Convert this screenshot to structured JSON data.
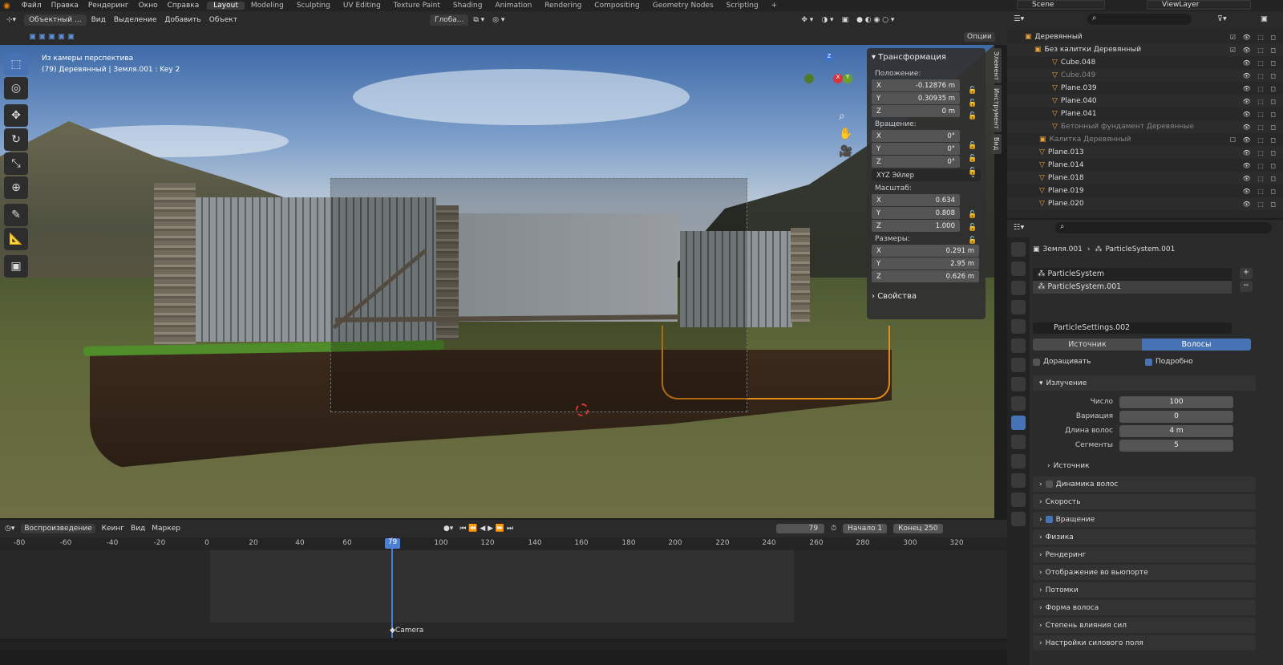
{
  "menu": [
    "Файл",
    "Правка",
    "Рендеринг",
    "Окно",
    "Справка"
  ],
  "workspaces": [
    "Layout",
    "Modeling",
    "Sculpting",
    "UV Editing",
    "Texture Paint",
    "Shading",
    "Animation",
    "Rendering",
    "Compositing",
    "Geometry Nodes",
    "Scripting"
  ],
  "active_workspace": "Layout",
  "scene": "Scene",
  "view_layer": "ViewLayer",
  "viewport_header": {
    "mode": "Объектный ...",
    "items": [
      "Вид",
      "Выделение",
      "Добавить",
      "Объект"
    ],
    "transform_orientation": "Глоба...",
    "options_label": "Опции"
  },
  "viewport_info": {
    "line1": "Из камеры перспектива",
    "line2": "(79) Деревянный | Земля.001 : Key 2"
  },
  "npanel": {
    "title": "Трансформация",
    "location_label": "Положение:",
    "location": [
      {
        "axis": "X",
        "value": "-0.12876 m"
      },
      {
        "axis": "Y",
        "value": "0.30935 m"
      },
      {
        "axis": "Z",
        "value": "0 m"
      }
    ],
    "rotation_label": "Вращение:",
    "rotation": [
      {
        "axis": "X",
        "value": "0°"
      },
      {
        "axis": "Y",
        "value": "0°"
      },
      {
        "axis": "Z",
        "value": "0°"
      }
    ],
    "rotation_mode": "XYZ Эйлер",
    "scale_label": "Масштаб:",
    "scale": [
      {
        "axis": "X",
        "value": "0.634"
      },
      {
        "axis": "Y",
        "value": "0.808"
      },
      {
        "axis": "Z",
        "value": "1.000"
      }
    ],
    "dimensions_label": "Размеры:",
    "dimensions": [
      {
        "axis": "X",
        "value": "0.291 m"
      },
      {
        "axis": "Y",
        "value": "2.95 m"
      },
      {
        "axis": "Z",
        "value": "0.626 m"
      }
    ],
    "properties_label": "Свойства",
    "tabs": [
      "Элемент",
      "Инструмент",
      "Вид"
    ]
  },
  "timeline": {
    "header": [
      "Воспроизведение",
      "Кеинг",
      "Вид",
      "Маркер"
    ],
    "current_frame": "79",
    "start_label": "Начало",
    "start": "1",
    "end_label": "Конец",
    "end": "250",
    "ruler": [
      "-80",
      "-60",
      "-40",
      "-20",
      "0",
      "20",
      "40",
      "60",
      "79",
      "100",
      "120",
      "140",
      "160",
      "180",
      "200",
      "220",
      "240",
      "260",
      "280",
      "300",
      "320"
    ],
    "marker": "Camera"
  },
  "outliner": {
    "rows": [
      {
        "name": "Деревянный",
        "dim": false
      },
      {
        "name": "Без калитки Деревянный",
        "dim": false
      },
      {
        "name": "Cube.048",
        "dim": false
      },
      {
        "name": "Cube.049",
        "dim": true
      },
      {
        "name": "Plane.039",
        "dim": false
      },
      {
        "name": "Plane.040",
        "dim": false
      },
      {
        "name": "Plane.041",
        "dim": false
      },
      {
        "name": "Бетонный фундамент Деревянные",
        "dim": true
      },
      {
        "name": "Калитка Деревянный",
        "dim": true
      },
      {
        "name": "Plane.013",
        "dim": false
      },
      {
        "name": "Plane.014",
        "dim": false
      },
      {
        "name": "Plane.018",
        "dim": false
      },
      {
        "name": "Plane.019",
        "dim": false
      },
      {
        "name": "Plane.020",
        "dim": false
      }
    ]
  },
  "properties": {
    "breadcrumb_obj": "Земля.001",
    "breadcrumb_ps": "ParticleSystem.001",
    "systems": [
      "ParticleSystem",
      "ParticleSystem.001"
    ],
    "settings_name": "ParticleSettings.002",
    "type_tabs": [
      "Источник",
      "Волосы"
    ],
    "advanced_left": "Доращивать",
    "advanced_right": "Подробно",
    "emission_label": "Излучение",
    "emission": [
      {
        "label": "Число",
        "value": "100"
      },
      {
        "label": "Вариация",
        "value": "0"
      },
      {
        "label": "Длина волос",
        "value": "4 m"
      },
      {
        "label": "Сегменты",
        "value": "5"
      }
    ],
    "source_sub": "Источник",
    "sections": [
      "Динамика волос",
      "Скорость",
      "Вращение",
      "Физика",
      "Рендеринг",
      "Отображение во вьюпорте",
      "Потомки",
      "Форма волоса",
      "Степень влияния сил",
      "Настройки силового поля"
    ]
  }
}
